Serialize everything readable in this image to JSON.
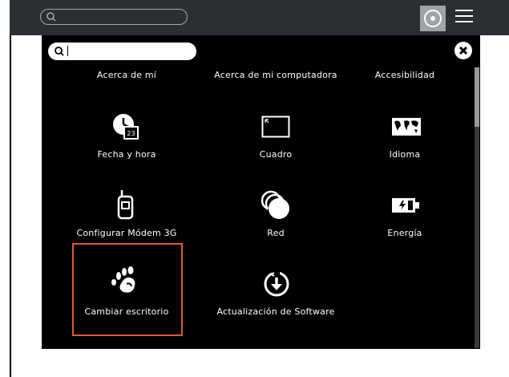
{
  "top_bar": {
    "search_placeholder": "",
    "activity_icon": "activity-ring-icon",
    "menu_icon": "hamburger-menu-icon"
  },
  "panel": {
    "search_value": "",
    "close_icon": "close-icon",
    "items": [
      {
        "label": "Acerca de mí"
      },
      {
        "label": "Acerca de mi computadora"
      },
      {
        "label": "Accesibilidad"
      },
      {
        "label": "Fecha y hora",
        "badge": "23"
      },
      {
        "label": "Cuadro"
      },
      {
        "label": "Idioma"
      },
      {
        "label": "Configurar Módem 3G"
      },
      {
        "label": "Red"
      },
      {
        "label": "Energía"
      },
      {
        "label": "Cambiar escritorio"
      },
      {
        "label": "Actualización de Software"
      }
    ]
  },
  "colors": {
    "top_bar_bg": "#2b2e33",
    "panel_bg": "#000000",
    "highlight": "#e05a2c"
  }
}
